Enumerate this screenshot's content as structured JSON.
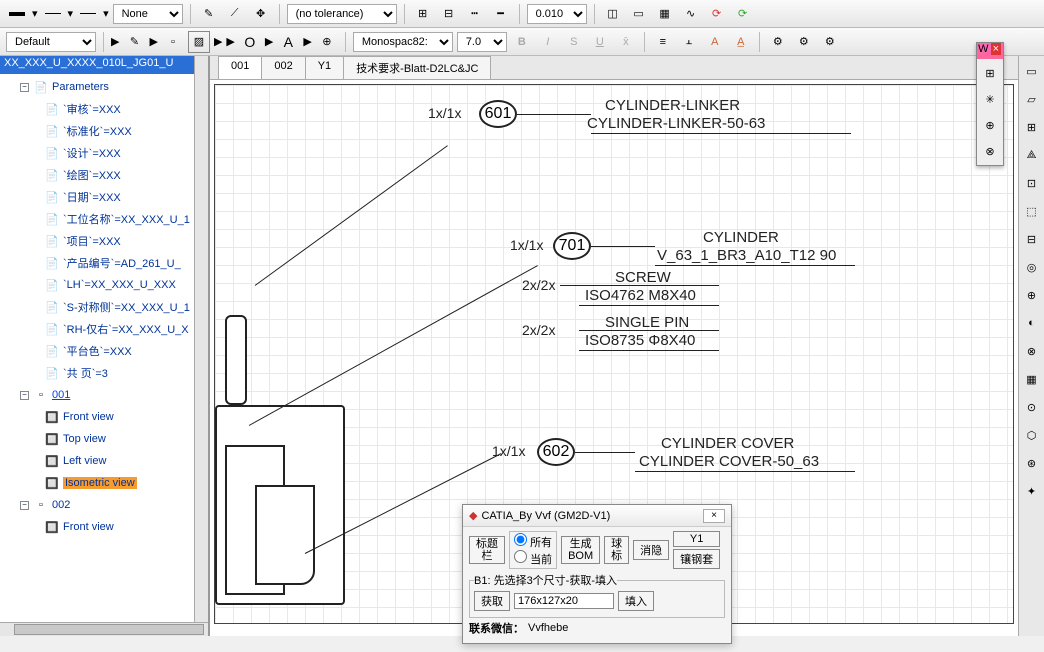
{
  "toolbar1": {
    "tolerance": "(no tolerance)",
    "none": "None",
    "value1": "0.010"
  },
  "toolbar2": {
    "style": "Default",
    "font": "Monospac82:",
    "fontSize": "7.0",
    "letter_O": "O",
    "letter_A": "A"
  },
  "tree": {
    "root": "XX_XXX_U_XXXX_010L_JG01_U",
    "parameters": "Parameters",
    "items": [
      "`审核`=XXX",
      "`标准化`=XXX",
      "`设计`=XXX",
      "`绘图`=XXX",
      "`日期`=XXX",
      "`工位名称`=XX_XXX_U_1",
      "`项目`=XXX",
      "`产品编号`=AD_261_U_",
      "`LH`=XX_XXX_U_XXX",
      "`S-对称侧`=XX_XXX_U_1",
      "`RH-仅右`=XX_XXX_U_X",
      "`平台色`=XXX",
      "`共 页`=3"
    ],
    "sheet1": "001",
    "views": [
      "Front view",
      "Top view",
      "Left view",
      "Isometric view"
    ],
    "sheet2": "002",
    "view2": "Front view"
  },
  "tabs": [
    "001",
    "002",
    "Y1",
    "技术要求-Blatt-D2LC&JC"
  ],
  "callouts": {
    "c601": {
      "num": "601",
      "ratio": "1x/1x",
      "line1": "CYLINDER-LINKER",
      "line2": "CYLINDER-LINKER-50-63"
    },
    "c701": {
      "num": "701",
      "ratio": "1x/1x",
      "line1": "CYLINDER",
      "line2": "V_63_1_BR3_A10_T12 90"
    },
    "screw": {
      "ratio": "2x/2x",
      "line1": "SCREW",
      "line2": "ISO4762  M8X40"
    },
    "pin": {
      "ratio": "2x/2x",
      "line1": "SINGLE PIN",
      "line2": "ISO8735  Φ8X40"
    },
    "c602": {
      "num": "602",
      "ratio": "1x/1x",
      "line1": "CYLINDER COVER",
      "line2": "CYLINDER COVER-50_63"
    }
  },
  "palette": {
    "title": "W"
  },
  "dialog": {
    "title": "CATIA_By Vvf (GM2D-V1)",
    "close": "×",
    "btn_titlebar": "标题\n栏",
    "radio_all": "所有",
    "radio_cur": "当前",
    "btn_bom": "生成\nBOM",
    "btn_ball": "球\n标",
    "btn_hide": "消隐",
    "btn_y1": "Y1",
    "btn_insert": "镶钢套",
    "hint": "B1: 先选择3个尺寸-获取-填入",
    "btn_get": "获取",
    "dims": "176x127x20",
    "btn_fill": "填入",
    "contact_label": "联系微信：",
    "contact_value": "Vvfhebe"
  }
}
